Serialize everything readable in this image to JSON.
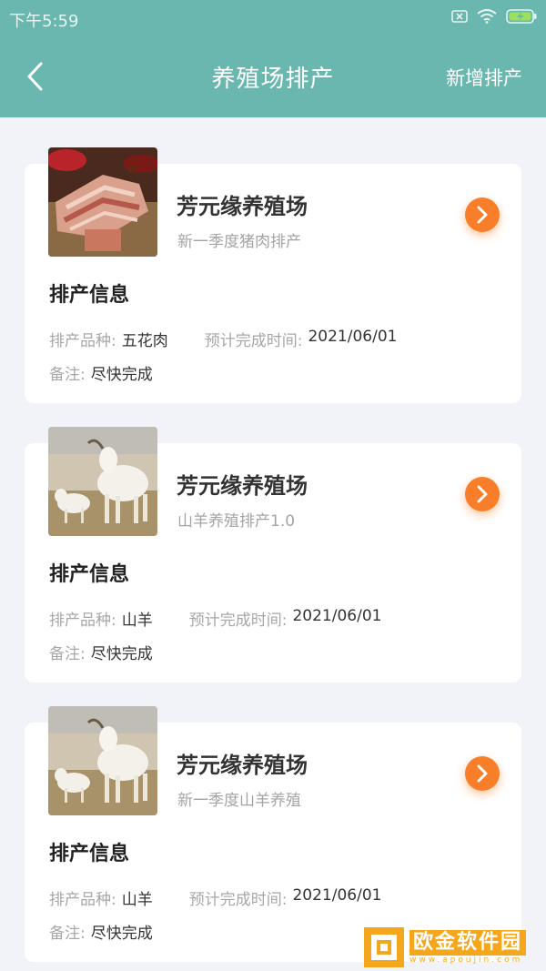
{
  "status_bar": {
    "time": "下午5:59",
    "icons": [
      "sim-off-icon",
      "wifi-icon",
      "battery-charging-icon"
    ]
  },
  "nav": {
    "back_icon": "chevron-left-icon",
    "title": "养殖场排产",
    "action_label": "新增排产"
  },
  "cards": [
    {
      "image": "pork-belly-photo",
      "farm_name": "芳元缘养殖场",
      "subtitle": "新一季度猪肉排产",
      "section_title": "排产信息",
      "variety_label": "排产品种:",
      "variety_value": "五花肉",
      "finish_label": "预计完成时间:",
      "finish_value": "2021/06/01",
      "note_label": "备注:",
      "note_value": "尽快完成"
    },
    {
      "image": "goats-photo",
      "farm_name": "芳元缘养殖场",
      "subtitle": "山羊养殖排产1.0",
      "section_title": "排产信息",
      "variety_label": "排产品种:",
      "variety_value": "山羊",
      "finish_label": "预计完成时间:",
      "finish_value": "2021/06/01",
      "note_label": "备注:",
      "note_value": "尽快完成"
    },
    {
      "image": "goats-photo",
      "farm_name": "芳元缘养殖场",
      "subtitle": "新一季度山羊养殖",
      "section_title": "排产信息",
      "variety_label": "排产品种:",
      "variety_value": "山羊",
      "finish_label": "预计完成时间:",
      "finish_value": "2021/06/01",
      "note_label": "备注:",
      "note_value": "尽快完成"
    }
  ],
  "watermark": {
    "main": "欧金软件园",
    "sub": "www.apoujin.com"
  },
  "colors": {
    "header": "#69b7ae",
    "accent_button": "#f97e29",
    "background": "#f1f3f8"
  }
}
